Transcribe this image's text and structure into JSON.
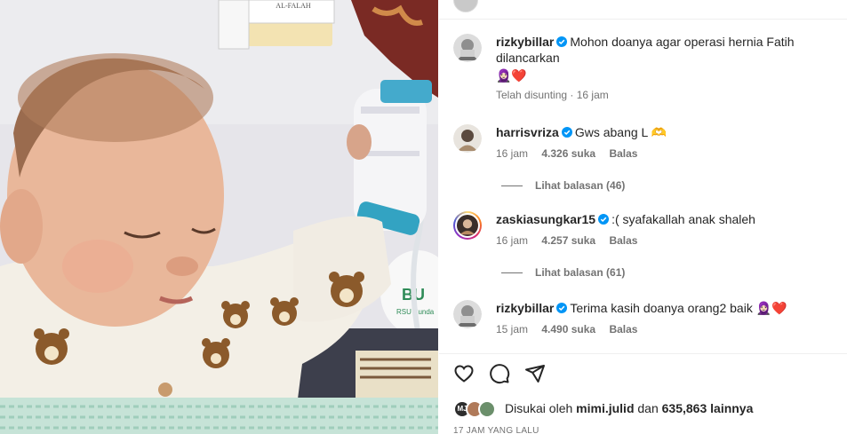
{
  "post": {
    "comments": [
      {
        "username": "rizkybillar",
        "verified": true,
        "text": "Mohon doanya agar operasi hernia Fatih dilancarkan",
        "emojis": "🧕🏻❤️",
        "time": "Telah disunting · 16 jam"
      },
      {
        "username": "harrisvriza",
        "verified": true,
        "text": "Gws abang L 🫶",
        "time": "16 jam",
        "likes": "4.326 suka",
        "reply": "Balas",
        "view_replies": "Lihat balasan (46)"
      },
      {
        "username": "zaskiasungkar15",
        "verified": true,
        "text": ":( syafakallah anak shaleh",
        "time": "16 jam",
        "likes": "4.257 suka",
        "reply": "Balas",
        "view_replies": "Lihat balasan (61)"
      },
      {
        "username": "rizkybillar",
        "verified": true,
        "text": "Terima kasih doanya orang2 baik 🧕🏻❤️",
        "time": "15 jam",
        "likes": "4.490 suka",
        "reply": "Balas"
      }
    ],
    "actions": {
      "like_icon": "heart-outline-icon",
      "comment_icon": "comment-bubble-icon",
      "share_icon": "paper-plane-icon"
    },
    "likes": {
      "prefix": "Disukai oleh ",
      "user": "mimi.julid",
      "middle": " dan ",
      "count": "635,863 lainnya",
      "first_avatar_initials": "MJ"
    },
    "time_ago": "17 JAM YANG LALU"
  },
  "photo": {
    "book_label": "AL-FALAH",
    "hospital_text": "BU",
    "hospital_sub": "RSU Bunda"
  },
  "colors": {
    "verified": "#0095f6",
    "heart": "#ed4956",
    "meta": "#737373"
  }
}
